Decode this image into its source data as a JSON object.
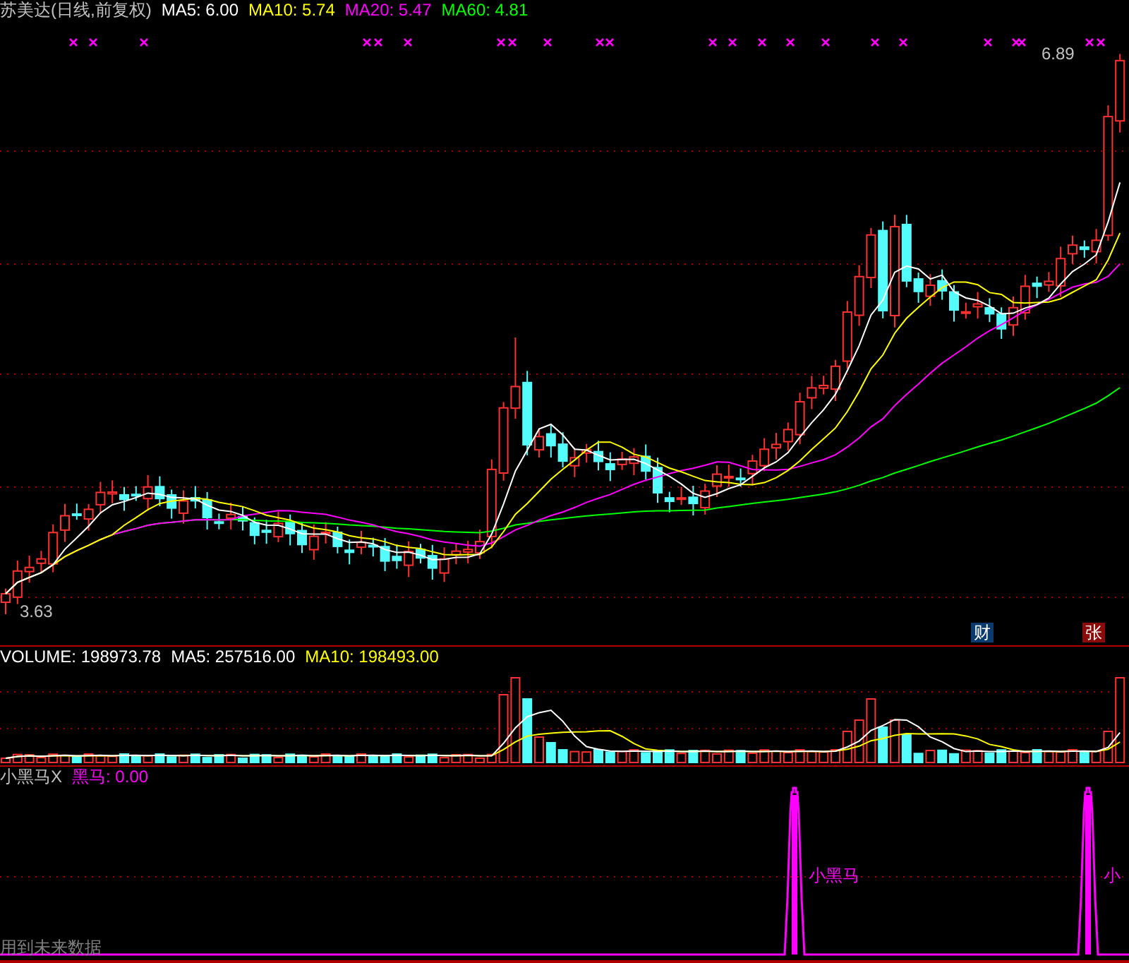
{
  "main_panel": {
    "title": "苏美达(日线,前复权)",
    "indicators": [
      {
        "label": "MA5: 6.00",
        "color": "#ffffff"
      },
      {
        "label": "MA10: 5.74",
        "color": "#ffff00"
      },
      {
        "label": "MA20: 5.47",
        "color": "#ff00ff"
      },
      {
        "label": "MA60: 4.81",
        "color": "#00ff00"
      }
    ],
    "high_label": "6.89",
    "low_label": "3.63",
    "badges": [
      {
        "text": "财",
        "color": "#0b3a6e"
      },
      {
        "text": "张",
        "color": "#8b0a0a"
      }
    ]
  },
  "volume_panel": {
    "indicators": [
      {
        "label": "VOLUME: 198973.78",
        "color": "#ffffff"
      },
      {
        "label": "MA5: 257516.00",
        "color": "#ffffff"
      },
      {
        "label": "MA10: 198493.00",
        "color": "#ffff00"
      }
    ]
  },
  "indicator_panel": {
    "title": "小黑马X",
    "indicators": [
      {
        "label": "黑马: 0.00",
        "color": "#ff00ff"
      }
    ],
    "signal_labels": [
      "小黑马",
      "小"
    ],
    "footnote": "用到未来数据"
  }
}
